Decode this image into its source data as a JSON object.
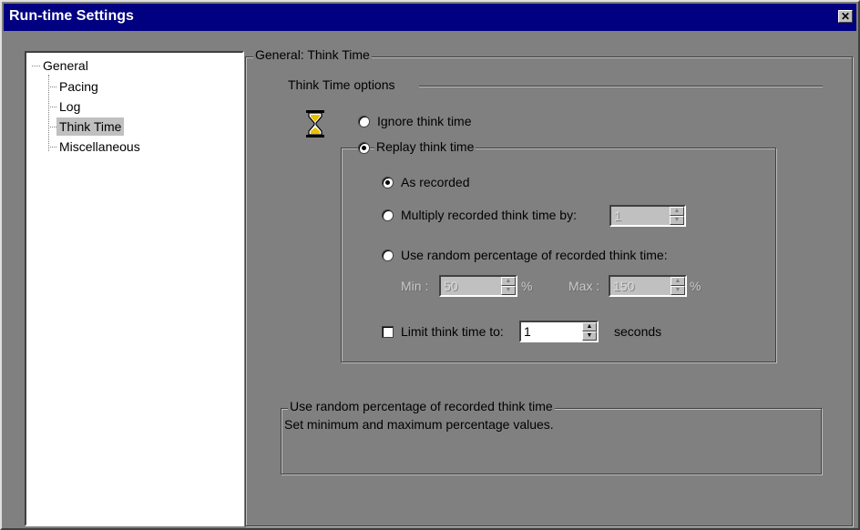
{
  "window": {
    "title": "Run-time Settings",
    "close_glyph": "✕"
  },
  "tree": {
    "root": "General",
    "children": [
      "Pacing",
      "Log",
      "Think Time",
      "Miscellaneous"
    ],
    "selected": "Think Time"
  },
  "panel": {
    "title": "General: Think Time",
    "options_title": "Think Time options",
    "ignore_label": "Ignore think time",
    "replay_label": "Replay think time",
    "as_recorded_label": "As recorded",
    "multiply_label": "Multiply recorded think time by:",
    "multiply_value": "1",
    "random_label": "Use random percentage of recorded think time:",
    "min_label": "Min :",
    "min_value": "50",
    "min_unit": "%",
    "max_label": "Max :",
    "max_value": "150",
    "max_unit": "%",
    "limit_label": "Limit think time to:",
    "limit_value": "1",
    "limit_unit": "seconds"
  },
  "description": {
    "title": "Use random percentage of recorded think time",
    "text": "Set minimum and maximum percentage values."
  },
  "state": {
    "ignore_selected": false,
    "replay_selected": true,
    "as_recorded_selected": true,
    "multiply_selected": false,
    "random_selected": false,
    "limit_checked": false
  },
  "icons": [
    "hourglass-icon",
    "close-icon",
    "spin-up-icon",
    "spin-down-icon"
  ],
  "colors": {
    "titlebar": "#000080",
    "background": "#808080",
    "tree": "#ffffff"
  }
}
